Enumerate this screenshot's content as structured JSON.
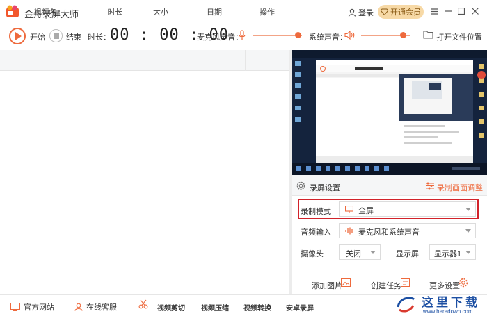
{
  "app": {
    "title": "金舟录屏大师"
  },
  "header": {
    "login_label": "登录",
    "vip_label": "开通会员"
  },
  "toolbar": {
    "start_label": "开始",
    "stop_label": "结束",
    "duration_label": "时长：",
    "timer": "00 : 00 : 00",
    "mic_label": "麦克风声音：",
    "mic_level": 0.92,
    "system_sound_label": "系统声音：",
    "system_level": 0.85,
    "open_folder_label": "打开文件位置"
  },
  "table": {
    "columns": [
      "视频名",
      "时长",
      "大小",
      "日期",
      "操作"
    ],
    "rows": []
  },
  "settings": {
    "title": "录屏设置",
    "adjust_label": "录制画面调整",
    "record_mode_label": "录制模式",
    "record_mode_value": "全屏",
    "audio_input_label": "音频输入",
    "audio_input_value": "麦克风和系统声音",
    "camera_label": "摄像头",
    "camera_value": "关闭",
    "display_label": "显示屏",
    "display_value": "显示器1",
    "add_image_label": "添加图片",
    "create_task_label": "创建任务",
    "more_settings_label": "更多设置"
  },
  "bottombar": {
    "website_label": "官方网站",
    "support_label": "在线客服",
    "edit_label": "视频剪切",
    "compress_label": "视频压缩",
    "convert_label": "视频转换",
    "android_label": "安卓录屏"
  },
  "watermark": {
    "title": "这里下载",
    "url": "www.heredown.com"
  },
  "colors": {
    "accent": "#ee6a3d",
    "vip_bg": "#f7d9a6",
    "highlight": "#d2232a"
  }
}
